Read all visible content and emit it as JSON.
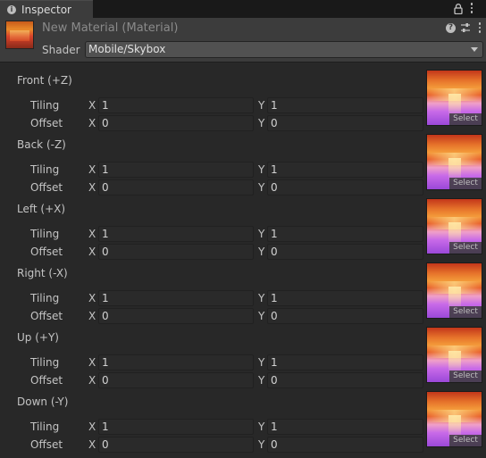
{
  "tab": {
    "title": "Inspector",
    "icon": "info-icon"
  },
  "header": {
    "material_name": "New Material (Material)",
    "shader_label": "Shader",
    "shader_value": "Mobile/Skybox"
  },
  "faces": [
    {
      "label": "Front (+Z)",
      "tiling_label": "Tiling",
      "offset_label": "Offset",
      "x_label": "X",
      "y_label": "Y",
      "tiling_x": "1",
      "tiling_y": "1",
      "offset_x": "0",
      "offset_y": "0",
      "select_label": "Select"
    },
    {
      "label": "Back (-Z)",
      "tiling_label": "Tiling",
      "offset_label": "Offset",
      "x_label": "X",
      "y_label": "Y",
      "tiling_x": "1",
      "tiling_y": "1",
      "offset_x": "0",
      "offset_y": "0",
      "select_label": "Select"
    },
    {
      "label": "Left (+X)",
      "tiling_label": "Tiling",
      "offset_label": "Offset",
      "x_label": "X",
      "y_label": "Y",
      "tiling_x": "1",
      "tiling_y": "1",
      "offset_x": "0",
      "offset_y": "0",
      "select_label": "Select"
    },
    {
      "label": "Right (-X)",
      "tiling_label": "Tiling",
      "offset_label": "Offset",
      "x_label": "X",
      "y_label": "Y",
      "tiling_x": "1",
      "tiling_y": "1",
      "offset_x": "0",
      "offset_y": "0",
      "select_label": "Select"
    },
    {
      "label": "Up (+Y)",
      "tiling_label": "Tiling",
      "offset_label": "Offset",
      "x_label": "X",
      "y_label": "Y",
      "tiling_x": "1",
      "tiling_y": "1",
      "offset_x": "0",
      "offset_y": "0",
      "select_label": "Select"
    },
    {
      "label": "Down (-Y)",
      "tiling_label": "Tiling",
      "offset_label": "Offset",
      "x_label": "X",
      "y_label": "Y",
      "tiling_x": "1",
      "tiling_y": "1",
      "offset_x": "0",
      "offset_y": "0",
      "select_label": "Select"
    }
  ],
  "colors": {
    "background": "#282828",
    "panel": "#3c3c3c",
    "field": "#2a2a2a",
    "text": "#c4c4c4"
  }
}
